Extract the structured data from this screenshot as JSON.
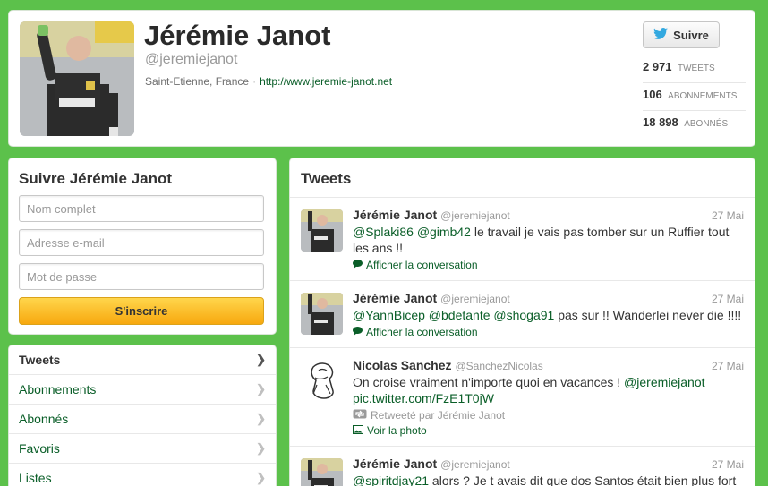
{
  "profile": {
    "name": "Jérémie Janot",
    "handle": "@jeremiejanot",
    "location": "Saint-Etienne, France",
    "url": "http://www.jeremie-janot.net",
    "follow_label": "Suivre",
    "stats": [
      {
        "number": "2 971",
        "label": "TWEETS"
      },
      {
        "number": "106",
        "label": "ABONNEMENTS"
      },
      {
        "number": "18 898",
        "label": "ABONNÉS"
      }
    ]
  },
  "signup": {
    "title": "Suivre Jérémie Janot",
    "name_placeholder": "Nom complet",
    "email_placeholder": "Adresse e-mail",
    "password_placeholder": "Mot de passe",
    "button_label": "S'inscrire"
  },
  "nav": {
    "items": [
      {
        "label": "Tweets"
      },
      {
        "label": "Abonnements"
      },
      {
        "label": "Abonnés"
      },
      {
        "label": "Favoris"
      },
      {
        "label": "Listes"
      }
    ]
  },
  "tweets": {
    "title": "Tweets",
    "items": [
      {
        "name": "Jérémie Janot",
        "handle": "@jeremiejanot",
        "time": "27 Mai",
        "mention1": "@Splaki86",
        "mention2": "@gimb42",
        "text": " le travail je vais pas tomber sur un Ruffier tout les ans !!",
        "action": "Afficher la conversation"
      },
      {
        "name": "Jérémie Janot",
        "handle": "@jeremiejanot",
        "time": "27 Mai",
        "mention1": "@YannBicep",
        "mention2": "@bdetante",
        "mention3": "@shoga91",
        "text": " pas sur !! Wanderlei never die !!!!",
        "action": "Afficher la conversation"
      },
      {
        "name": "Nicolas Sanchez",
        "handle": "@SanchezNicolas",
        "time": "27 Mai",
        "text": "On croise vraiment n'importe quoi en vacances ! ",
        "mention1": "@jeremiejanot",
        "link": "pic.twitter.com/FzE1T0jW",
        "retweeted_by": "Retweeté par Jérémie Janot",
        "action": "Voir la photo"
      },
      {
        "name": "Jérémie Janot",
        "handle": "@jeremiejanot",
        "time": "27 Mai",
        "mention1": "@spiritdjay21",
        "text": " alors ? Je t avais dit que dos Santos était bien plus fort"
      }
    ]
  },
  "colors": {
    "background": "#5cc14b",
    "link": "#0a5e28",
    "signup_button": "#f7a80e",
    "twitter_bird": "#33a9e0"
  },
  "icons": {
    "follow": "twitter-bird-icon",
    "conversation": "speech-bubble-icon",
    "retweet": "retweet-icon",
    "photo": "photo-icon",
    "nav": "chevron-right-icon"
  }
}
